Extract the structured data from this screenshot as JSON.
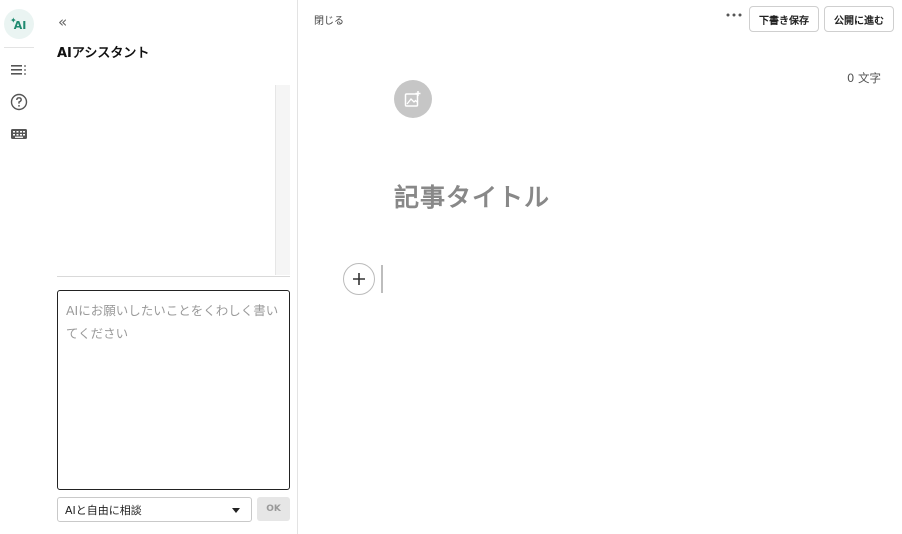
{
  "rail": {
    "ai_label": "AI",
    "icons": [
      "ai-assistant-icon",
      "table-of-contents-icon",
      "help-icon",
      "keyboard-icon"
    ]
  },
  "assistant": {
    "title": "AIアシスタント",
    "prompt_placeholder": "AIにお願いしたいことをくわしく書いてください",
    "prompt_value": "",
    "mode_selected": "AIと自由に相談",
    "ok_label": "OK"
  },
  "editor": {
    "close_label": "閉じる",
    "draft_save_label": "下書き保存",
    "publish_label": "公開に進む",
    "char_count_value": "0",
    "char_count_unit": "文字",
    "title_placeholder": "記事タイトル"
  },
  "colors": {
    "accent": "#1f8a70",
    "ai_badge_bg": "#eaf4f2",
    "image_button_bg": "#c6c6c6",
    "title_placeholder": "#888888"
  }
}
